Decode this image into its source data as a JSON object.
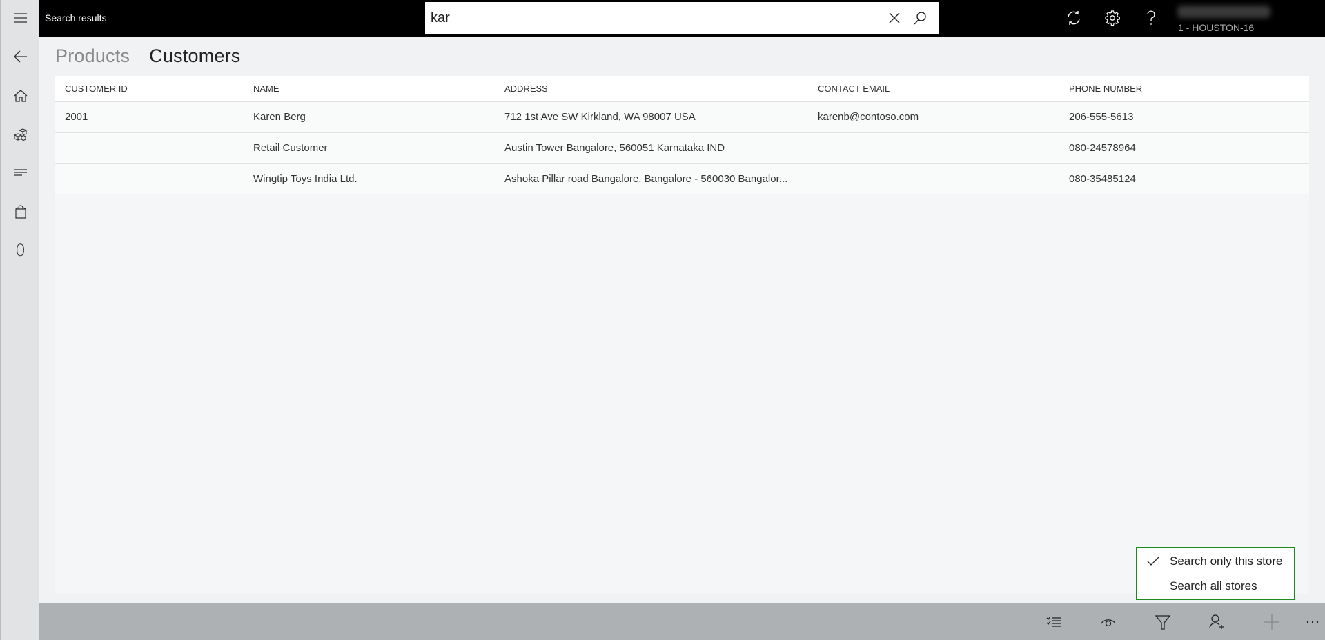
{
  "topbar": {
    "title": "Search results",
    "search": {
      "value": "kar",
      "placeholder": ""
    },
    "icons": {
      "clear": "close-icon",
      "search": "search-icon",
      "sync": "sync-icon",
      "settings": "gear-icon",
      "help": "help-icon"
    },
    "store": "1 - HOUSTON-16"
  },
  "sidebar": {
    "items": [
      {
        "name": "menu",
        "icon": "hamburger-icon"
      },
      {
        "name": "back",
        "icon": "back-arrow-icon"
      },
      {
        "name": "home",
        "icon": "home-icon"
      },
      {
        "name": "products",
        "icon": "products-icon"
      },
      {
        "name": "transactions",
        "icon": "lines-icon"
      },
      {
        "name": "cart",
        "icon": "shopping-bag-icon"
      }
    ],
    "cart_count": "0"
  },
  "tabs": [
    {
      "label": "Products",
      "active": false
    },
    {
      "label": "Customers",
      "active": true
    }
  ],
  "table": {
    "headers": [
      "CUSTOMER ID",
      "NAME",
      "ADDRESS",
      "CONTACT EMAIL",
      "PHONE NUMBER"
    ],
    "rows": [
      [
        "2001",
        "Karen Berg",
        "712 1st Ave SW Kirkland, WA 98007 USA",
        "karenb@contoso.com",
        "206-555-5613"
      ],
      [
        "",
        "Retail Customer",
        "Austin Tower Bangalore, 560051 Karnataka IND",
        "",
        "080-24578964"
      ],
      [
        "",
        "Wingtip Toys India Ltd.",
        "Ashoka Pillar road Bangalore, Bangalore - 560030 Bangalor...",
        "",
        "080-35485124"
      ]
    ]
  },
  "store_popup": {
    "items": [
      {
        "label": "Search only this store",
        "checked": true
      },
      {
        "label": "Search all stores",
        "checked": false
      }
    ],
    "border_color": "#1e8a1e"
  },
  "bottombar": {
    "icons": [
      "checklist-icon",
      "view-icon",
      "filter-icon",
      "add-customer-icon",
      "add-icon",
      "more-icon"
    ]
  }
}
